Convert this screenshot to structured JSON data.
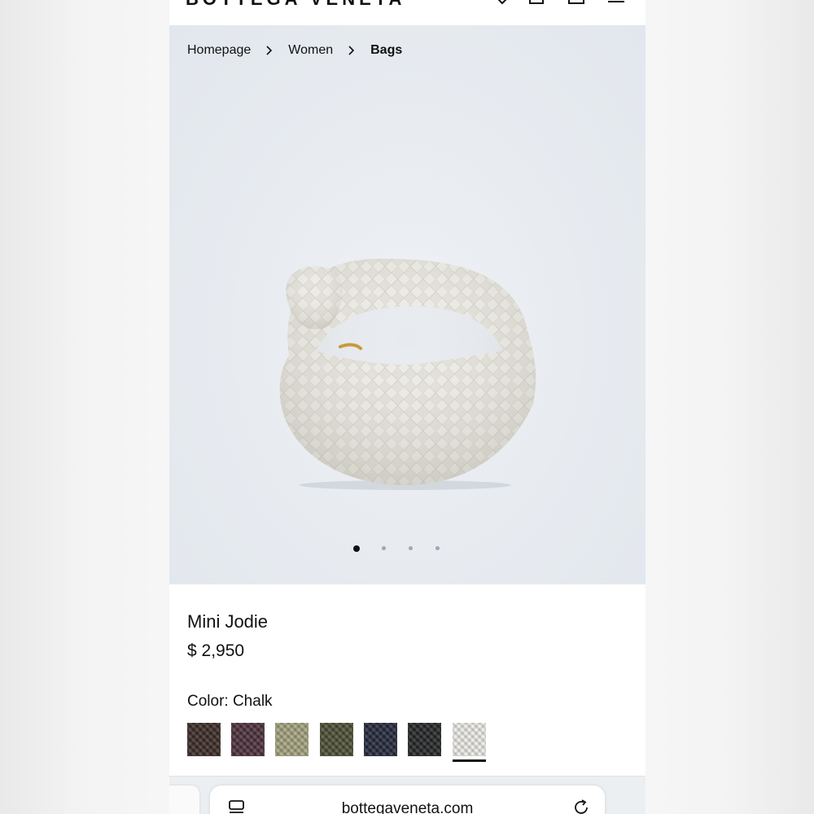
{
  "header": {
    "logo": "BOTTEGA VENETA",
    "icons": [
      "heart-icon",
      "shopping-bag-icon",
      "account-icon",
      "menu-icon"
    ]
  },
  "breadcrumb": {
    "items": [
      "Homepage",
      "Women",
      "Bags"
    ],
    "separator_icon": "chevron-right-icon"
  },
  "gallery": {
    "image": "bag-image",
    "slide_count": 4,
    "active_slide": 1
  },
  "product": {
    "name": "Mini Jodie",
    "price": "$ 2,950",
    "color_label": "Color: Chalk",
    "swatches": [
      {
        "color": "#3a2a26"
      },
      {
        "color": "#4b2f3a"
      },
      {
        "color": "#a4a27e"
      },
      {
        "color": "#4b4d33"
      },
      {
        "color": "#23273a"
      },
      {
        "color": "#232526"
      },
      {
        "color": "#ecebe6",
        "selected": true
      }
    ]
  },
  "browser": {
    "url": "bottegaveneta.com",
    "icons": [
      "tabs-icon",
      "reload-icon"
    ]
  }
}
